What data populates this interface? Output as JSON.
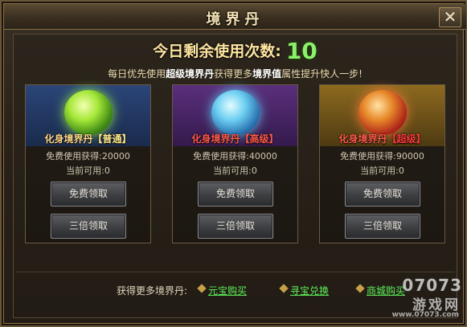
{
  "window": {
    "title": "境界丹",
    "close_label": "✕"
  },
  "header": {
    "count_label": "今日剩余使用次数:",
    "count_value": "10",
    "tip_prefix": "每日优先使用",
    "tip_highlight1": "超级境界丹",
    "tip_middle": "获得更多",
    "tip_highlight2": "境界值",
    "tip_suffix": "属性提升快人一步!"
  },
  "cards": [
    {
      "name_base": "化身境界丹",
      "grade": "【普通】",
      "free_text": "免费使用获得:20000",
      "avail_text": "当前可用:0",
      "free_btn": "免费领取",
      "triple_btn": "三倍领取",
      "orb_icon": "green-orb-icon",
      "theme_color": "#2b4578"
    },
    {
      "name_base": "化身境界丹",
      "grade": "【高级】",
      "free_text": "免费使用获得:40000",
      "avail_text": "当前可用:0",
      "free_btn": "免费领取",
      "triple_btn": "三倍领取",
      "orb_icon": "blue-orb-icon",
      "theme_color": "#5a2f7d"
    },
    {
      "name_base": "化身境界丹",
      "grade": "【超级】",
      "free_text": "免费使用获得:90000",
      "avail_text": "当前可用:0",
      "free_btn": "免费领取",
      "triple_btn": "三倍领取",
      "orb_icon": "red-gold-orb-icon",
      "theme_color": "#8d6a1f"
    }
  ],
  "footer": {
    "label": "获得更多境界丹:",
    "links": [
      "元宝购买",
      "寻宝兑换",
      "商城购买"
    ]
  },
  "watermark": {
    "logo": "07073",
    "cn": "游戏网",
    "url": "www.07073.com"
  }
}
